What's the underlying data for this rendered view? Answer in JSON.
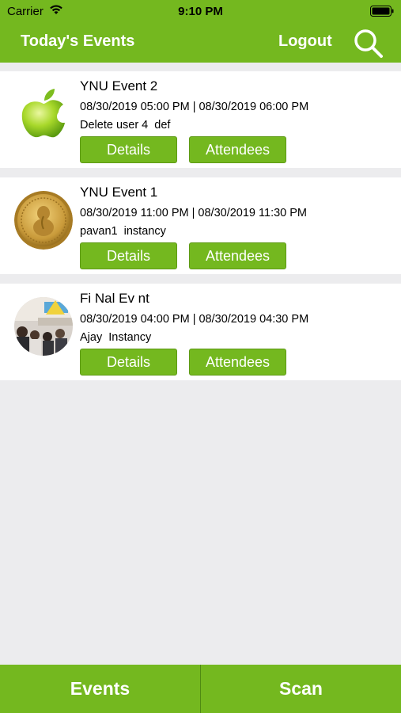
{
  "status_bar": {
    "carrier": "Carrier",
    "time": "9:10 PM"
  },
  "nav": {
    "title": "Today's Events",
    "logout_label": "Logout"
  },
  "events": [
    {
      "title": "YNU Event 2",
      "dates": "08/30/2019 05:00 PM | 08/30/2019 06:00 PM",
      "organizer": "Delete user 4  def",
      "thumbnail": "apple-logo",
      "details_label": "Details",
      "attendees_label": "Attendees"
    },
    {
      "title": "YNU Event 1",
      "dates": "08/30/2019 11:00 PM | 08/30/2019 11:30 PM",
      "organizer": "pavan1  instancy",
      "thumbnail": "gold-coin",
      "details_label": "Details",
      "attendees_label": "Attendees"
    },
    {
      "title": "Fi Nal Ev nt",
      "dates": "08/30/2019 04:00 PM | 08/30/2019 04:30 PM",
      "organizer": "Ajay  Instancy",
      "thumbnail": "event-photo",
      "details_label": "Details",
      "attendees_label": "Attendees"
    }
  ],
  "tabs": {
    "events_label": "Events",
    "scan_label": "Scan"
  },
  "colors": {
    "brand_green": "#74b81f",
    "background": "#ececee"
  }
}
